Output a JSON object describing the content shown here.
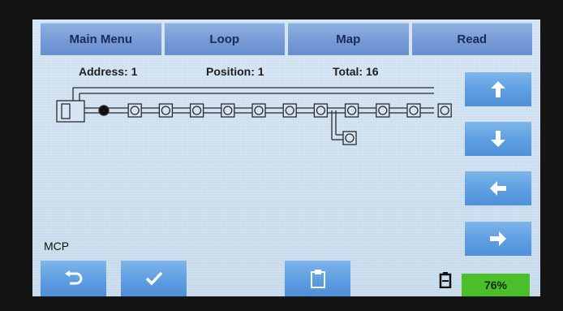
{
  "tabs": [
    {
      "label": "Main Menu"
    },
    {
      "label": "Loop"
    },
    {
      "label": "Map"
    },
    {
      "label": "Read"
    }
  ],
  "info": {
    "address": "Address: 1",
    "position": "Position: 1",
    "total": "Total: 16"
  },
  "map": {
    "main_line_devices": 12,
    "selected_device_index": 1,
    "branch_devices": 1
  },
  "nav": {
    "up_icon": "arrow-up-icon",
    "down_icon": "arrow-down-icon",
    "left_icon": "arrow-left-icon",
    "right_icon": "arrow-right-icon"
  },
  "panel_label": "MCP",
  "bottom": {
    "back_icon": "undo-icon",
    "confirm_icon": "checkmark-icon",
    "save_icon": "clipboard-icon"
  },
  "battery": {
    "percent_label": "76%",
    "level": 0.76,
    "color": "#4bbf2a"
  }
}
